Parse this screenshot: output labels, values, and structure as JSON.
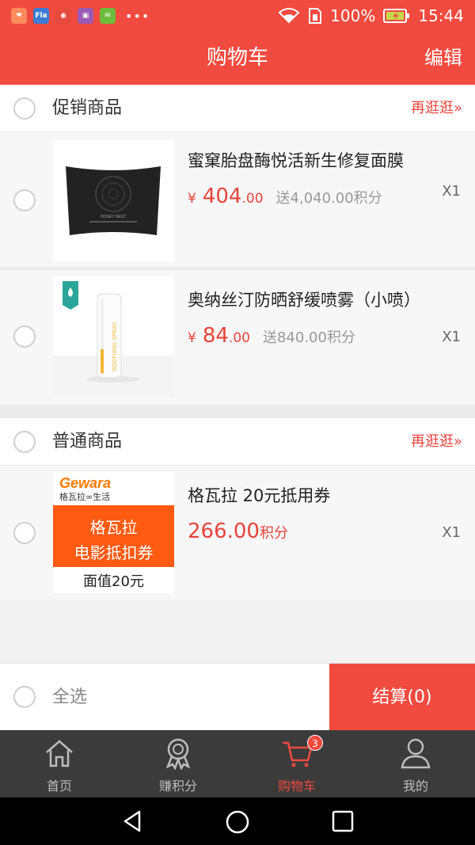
{
  "status_bar": {
    "app_icons": [
      {
        "name": "app-icon-1",
        "color": "#ff8a5c",
        "glyph": "❤"
      },
      {
        "name": "app-icon-2",
        "color": "#3a7bd5",
        "glyph": "Fla"
      },
      {
        "name": "app-icon-3",
        "color": "#e64a3c",
        "glyph": "◉"
      },
      {
        "name": "app-icon-4",
        "color": "#9b59b6",
        "glyph": "▣"
      },
      {
        "name": "app-icon-5",
        "color": "#6dbb3a",
        "glyph": "✉"
      }
    ],
    "more": "•••",
    "battery": "100%",
    "time": "15:44"
  },
  "header": {
    "title": "购物车",
    "edit_label": "编辑"
  },
  "sections": [
    {
      "title": "促销商品",
      "more_label": "再逛逛»",
      "items": [
        {
          "name": "蜜窠胎盘酶悦活新生修复面膜",
          "currency": "¥",
          "price_int": "404",
          "price_dec": ".00",
          "bonus": "送4,040.00积分",
          "qty": "X1",
          "thumb_label": "HONEY NEST"
        },
        {
          "name": "奥纳丝汀防晒舒缓喷雾（小喷）",
          "currency": "¥",
          "price_int": "84",
          "price_dec": ".00",
          "bonus": "送840.00积分",
          "qty": "X1",
          "thumb_label": "SOOTHING SPRAY"
        }
      ]
    },
    {
      "title": "普通商品",
      "more_label": "再逛逛»",
      "items": [
        {
          "name": "格瓦拉  20元抵用券",
          "points_price": "266.00",
          "points_unit": "积分",
          "qty": "X1",
          "thumb": {
            "brand": "Gewara",
            "brand_sub": "格瓦拉∞生活",
            "line1": "格瓦拉",
            "line2": "电影抵扣券",
            "face_value": "面值20元"
          }
        }
      ]
    }
  ],
  "footer": {
    "select_all_label": "全选",
    "checkout_label": "结算(0)"
  },
  "tabs": [
    {
      "label": "首页",
      "icon": "home-icon",
      "active": false
    },
    {
      "label": "赚积分",
      "icon": "medal-icon",
      "active": false
    },
    {
      "label": "购物车",
      "icon": "cart-icon",
      "active": true,
      "badge": "3"
    },
    {
      "label": "我的",
      "icon": "user-icon",
      "active": false
    }
  ],
  "colors": {
    "primary": "#f14a3e",
    "price": "#e8443a",
    "tab_bg": "#3b3b3b"
  }
}
